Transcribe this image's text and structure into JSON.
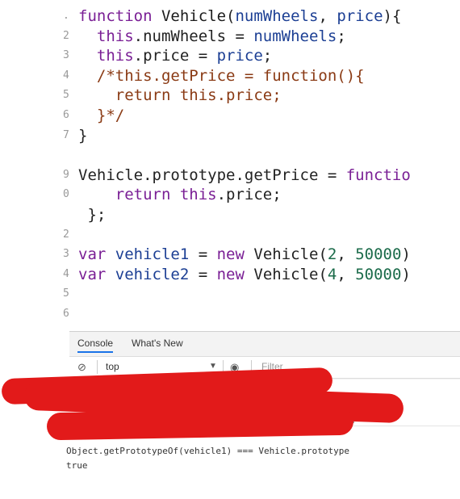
{
  "editor": {
    "gutter_marks": [
      ".",
      "2",
      "3",
      "4",
      "5",
      "6",
      "7",
      "",
      "9",
      "0",
      "",
      "2",
      "3",
      "4",
      "5",
      "6"
    ],
    "lines": [
      [
        {
          "t": "function ",
          "c": "kw"
        },
        {
          "t": "Vehicle",
          "c": "fn"
        },
        {
          "t": "(",
          "c": "plain"
        },
        {
          "t": "numWheels",
          "c": "prm"
        },
        {
          "t": ", ",
          "c": "plain"
        },
        {
          "t": "price",
          "c": "prm"
        },
        {
          "t": "){",
          "c": "plain"
        }
      ],
      [
        {
          "t": "  this",
          "c": "kw"
        },
        {
          "t": ".numWheels = ",
          "c": "plain"
        },
        {
          "t": "numWheels",
          "c": "prm"
        },
        {
          "t": ";",
          "c": "plain"
        }
      ],
      [
        {
          "t": "  this",
          "c": "kw"
        },
        {
          "t": ".price = ",
          "c": "plain"
        },
        {
          "t": "price",
          "c": "prm"
        },
        {
          "t": ";",
          "c": "plain"
        }
      ],
      [
        {
          "t": "  /*this.getPrice = function(){",
          "c": "cmt"
        }
      ],
      [
        {
          "t": "    return this.price;",
          "c": "cmt"
        }
      ],
      [
        {
          "t": "  }*/",
          "c": "cmt"
        }
      ],
      [
        {
          "t": "}",
          "c": "plain"
        }
      ],
      [
        {
          "t": "",
          "c": "plain"
        }
      ],
      [
        {
          "t": "Vehicle.prototype.getPrice = ",
          "c": "plain"
        },
        {
          "t": "functio",
          "c": "kw"
        }
      ],
      [
        {
          "t": "    return ",
          "c": "kw"
        },
        {
          "t": "this",
          "c": "kw"
        },
        {
          "t": ".price;",
          "c": "plain"
        }
      ],
      [
        {
          "t": " };",
          "c": "plain"
        }
      ],
      [
        {
          "t": "",
          "c": "plain"
        }
      ],
      [
        {
          "t": "var ",
          "c": "kw"
        },
        {
          "t": "vehicle1",
          "c": "prm"
        },
        {
          "t": " = ",
          "c": "plain"
        },
        {
          "t": "new ",
          "c": "kw"
        },
        {
          "t": "Vehicle(",
          "c": "plain"
        },
        {
          "t": "2",
          "c": "num"
        },
        {
          "t": ", ",
          "c": "plain"
        },
        {
          "t": "50000",
          "c": "num"
        },
        {
          "t": ")",
          "c": "plain"
        }
      ],
      [
        {
          "t": "var ",
          "c": "kw"
        },
        {
          "t": "vehicle2",
          "c": "prm"
        },
        {
          "t": " = ",
          "c": "plain"
        },
        {
          "t": "new ",
          "c": "kw"
        },
        {
          "t": "Vehicle(",
          "c": "plain"
        },
        {
          "t": "4",
          "c": "num"
        },
        {
          "t": ", ",
          "c": "plain"
        },
        {
          "t": "50000",
          "c": "num"
        },
        {
          "t": ")",
          "c": "plain"
        }
      ]
    ]
  },
  "devtools": {
    "tabs": [
      "Console",
      "What's New"
    ],
    "context": "top",
    "filter_placeholder": "Filter"
  },
  "console": {
    "partial_text": "ype",
    "command": "Object.getPrototypeOf(vehicle1) === Vehicle.prototype",
    "result": "true"
  },
  "colors": {
    "redaction": "#e21a1a",
    "tab_accent": "#1a73e8"
  }
}
